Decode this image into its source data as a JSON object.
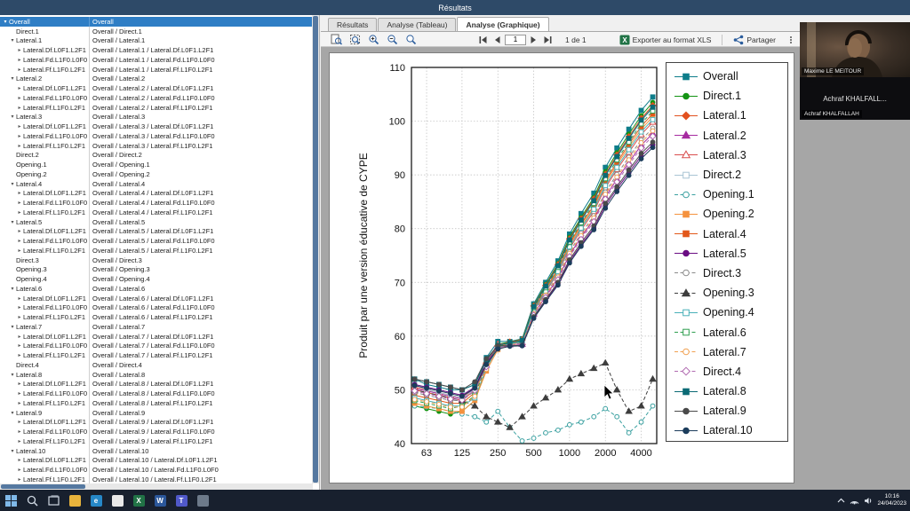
{
  "window": {
    "title": "Résultats"
  },
  "tabs": [
    {
      "label": "Résultats",
      "active": false
    },
    {
      "label": "Analyse (Tableau)",
      "active": false
    },
    {
      "label": "Analyse (Graphique)",
      "active": true
    }
  ],
  "toolbar": {
    "page_value": "1",
    "page_indicator": "1 de 1",
    "export_label": "Exporter au format XLS",
    "share_label": "Partager"
  },
  "tree": {
    "rows": [
      {
        "label": "Overall",
        "path": "Overall",
        "indent": 0,
        "expand": "open",
        "selected": true
      },
      {
        "label": "Direct.1",
        "path": "Overall / Direct.1",
        "indent": 1,
        "expand": "none"
      },
      {
        "label": "Lateral.1",
        "path": "Overall / Lateral.1",
        "indent": 1,
        "expand": "open"
      },
      {
        "label": "Lateral.Df.L0F1.L2F1",
        "path": "Overall / Lateral.1 / Lateral.Df.L0F1.L2F1",
        "indent": 2,
        "expand": "closed"
      },
      {
        "label": "Lateral.Fd.L1F0.L0F0",
        "path": "Overall / Lateral.1 / Lateral.Fd.L1F0.L0F0",
        "indent": 2,
        "expand": "closed"
      },
      {
        "label": "Lateral.Ff.L1F0.L2F1",
        "path": "Overall / Lateral.1 / Lateral.Ff.L1F0.L2F1",
        "indent": 2,
        "expand": "closed"
      },
      {
        "label": "Lateral.2",
        "path": "Overall / Lateral.2",
        "indent": 1,
        "expand": "open"
      },
      {
        "label": "Lateral.Df.L0F1.L2F1",
        "path": "Overall / Lateral.2 / Lateral.Df.L0F1.L2F1",
        "indent": 2,
        "expand": "closed"
      },
      {
        "label": "Lateral.Fd.L1F0.L0F0",
        "path": "Overall / Lateral.2 / Lateral.Fd.L1F0.L0F0",
        "indent": 2,
        "expand": "closed"
      },
      {
        "label": "Lateral.Ff.L1F0.L2F1",
        "path": "Overall / Lateral.2 / Lateral.Ff.L1F0.L2F1",
        "indent": 2,
        "expand": "closed"
      },
      {
        "label": "Lateral.3",
        "path": "Overall / Lateral.3",
        "indent": 1,
        "expand": "open"
      },
      {
        "label": "Lateral.Df.L0F1.L2F1",
        "path": "Overall / Lateral.3 / Lateral.Df.L0F1.L2F1",
        "indent": 2,
        "expand": "closed"
      },
      {
        "label": "Lateral.Fd.L1F0.L0F0",
        "path": "Overall / Lateral.3 / Lateral.Fd.L1F0.L0F0",
        "indent": 2,
        "expand": "closed"
      },
      {
        "label": "Lateral.Ff.L1F0.L2F1",
        "path": "Overall / Lateral.3 / Lateral.Ff.L1F0.L2F1",
        "indent": 2,
        "expand": "closed"
      },
      {
        "label": "Direct.2",
        "path": "Overall / Direct.2",
        "indent": 1,
        "expand": "none"
      },
      {
        "label": "Opening.1",
        "path": "Overall / Opening.1",
        "indent": 1,
        "expand": "none"
      },
      {
        "label": "Opening.2",
        "path": "Overall / Opening.2",
        "indent": 1,
        "expand": "none"
      },
      {
        "label": "Lateral.4",
        "path": "Overall / Lateral.4",
        "indent": 1,
        "expand": "open"
      },
      {
        "label": "Lateral.Df.L0F1.L2F1",
        "path": "Overall / Lateral.4 / Lateral.Df.L0F1.L2F1",
        "indent": 2,
        "expand": "closed"
      },
      {
        "label": "Lateral.Fd.L1F0.L0F0",
        "path": "Overall / Lateral.4 / Lateral.Fd.L1F0.L0F0",
        "indent": 2,
        "expand": "closed"
      },
      {
        "label": "Lateral.Ff.L1F0.L2F1",
        "path": "Overall / Lateral.4 / Lateral.Ff.L1F0.L2F1",
        "indent": 2,
        "expand": "closed"
      },
      {
        "label": "Lateral.5",
        "path": "Overall / Lateral.5",
        "indent": 1,
        "expand": "open"
      },
      {
        "label": "Lateral.Df.L0F1.L2F1",
        "path": "Overall / Lateral.5 / Lateral.Df.L0F1.L2F1",
        "indent": 2,
        "expand": "closed"
      },
      {
        "label": "Lateral.Fd.L1F0.L0F0",
        "path": "Overall / Lateral.5 / Lateral.Fd.L1F0.L0F0",
        "indent": 2,
        "expand": "closed"
      },
      {
        "label": "Lateral.Ff.L1F0.L2F1",
        "path": "Overall / Lateral.5 / Lateral.Ff.L1F0.L2F1",
        "indent": 2,
        "expand": "closed"
      },
      {
        "label": "Direct.3",
        "path": "Overall / Direct.3",
        "indent": 1,
        "expand": "none"
      },
      {
        "label": "Opening.3",
        "path": "Overall / Opening.3",
        "indent": 1,
        "expand": "none"
      },
      {
        "label": "Opening.4",
        "path": "Overall / Opening.4",
        "indent": 1,
        "expand": "none"
      },
      {
        "label": "Lateral.6",
        "path": "Overall / Lateral.6",
        "indent": 1,
        "expand": "open"
      },
      {
        "label": "Lateral.Df.L0F1.L2F1",
        "path": "Overall / Lateral.6 / Lateral.Df.L0F1.L2F1",
        "indent": 2,
        "expand": "closed"
      },
      {
        "label": "Lateral.Fd.L1F0.L0F0",
        "path": "Overall / Lateral.6 / Lateral.Fd.L1F0.L0F0",
        "indent": 2,
        "expand": "closed"
      },
      {
        "label": "Lateral.Ff.L1F0.L2F1",
        "path": "Overall / Lateral.6 / Lateral.Ff.L1F0.L2F1",
        "indent": 2,
        "expand": "closed"
      },
      {
        "label": "Lateral.7",
        "path": "Overall / Lateral.7",
        "indent": 1,
        "expand": "open"
      },
      {
        "label": "Lateral.Df.L0F1.L2F1",
        "path": "Overall / Lateral.7 / Lateral.Df.L0F1.L2F1",
        "indent": 2,
        "expand": "closed"
      },
      {
        "label": "Lateral.Fd.L1F0.L0F0",
        "path": "Overall / Lateral.7 / Lateral.Fd.L1F0.L0F0",
        "indent": 2,
        "expand": "closed"
      },
      {
        "label": "Lateral.Ff.L1F0.L2F1",
        "path": "Overall / Lateral.7 / Lateral.Ff.L1F0.L2F1",
        "indent": 2,
        "expand": "closed"
      },
      {
        "label": "Direct.4",
        "path": "Overall / Direct.4",
        "indent": 1,
        "expand": "none"
      },
      {
        "label": "Lateral.8",
        "path": "Overall / Lateral.8",
        "indent": 1,
        "expand": "open"
      },
      {
        "label": "Lateral.Df.L0F1.L2F1",
        "path": "Overall / Lateral.8 / Lateral.Df.L0F1.L2F1",
        "indent": 2,
        "expand": "closed"
      },
      {
        "label": "Lateral.Fd.L1F0.L0F0",
        "path": "Overall / Lateral.8 / Lateral.Fd.L1F0.L0F0",
        "indent": 2,
        "expand": "closed"
      },
      {
        "label": "Lateral.Ff.L1F0.L2F1",
        "path": "Overall / Lateral.8 / Lateral.Ff.L1F0.L2F1",
        "indent": 2,
        "expand": "closed"
      },
      {
        "label": "Lateral.9",
        "path": "Overall / Lateral.9",
        "indent": 1,
        "expand": "open"
      },
      {
        "label": "Lateral.Df.L0F1.L2F1",
        "path": "Overall / Lateral.9 / Lateral.Df.L0F1.L2F1",
        "indent": 2,
        "expand": "closed"
      },
      {
        "label": "Lateral.Fd.L1F0.L0F0",
        "path": "Overall / Lateral.9 / Lateral.Fd.L1F0.L0F0",
        "indent": 2,
        "expand": "closed"
      },
      {
        "label": "Lateral.Ff.L1F0.L2F1",
        "path": "Overall / Lateral.9 / Lateral.Ff.L1F0.L2F1",
        "indent": 2,
        "expand": "closed"
      },
      {
        "label": "Lateral.10",
        "path": "Overall / Lateral.10",
        "indent": 1,
        "expand": "open"
      },
      {
        "label": "Lateral.Df.L0F1.L2F1",
        "path": "Overall / Lateral.10 / Lateral.Df.L0F1.L2F1",
        "indent": 2,
        "expand": "closed"
      },
      {
        "label": "Lateral.Fd.L1F0.L0F0",
        "path": "Overall / Lateral.10 / Lateral.Fd.L1F0.L0F0",
        "indent": 2,
        "expand": "closed"
      },
      {
        "label": "Lateral.Ff.L1F0.L2F1",
        "path": "Overall / Lateral.10 / Lateral.Ff.L1F0.L2F1",
        "indent": 2,
        "expand": "closed"
      }
    ]
  },
  "chart_data": {
    "type": "line",
    "x_scale": "log",
    "x": [
      50,
      63,
      80,
      100,
      125,
      160,
      200,
      250,
      315,
      400,
      500,
      630,
      800,
      1000,
      1250,
      1600,
      2000,
      2500,
      3150,
      4000,
      5000
    ],
    "x_ticks": [
      63,
      125,
      250,
      500,
      1000,
      2000,
      4000
    ],
    "ylabel": "Produit par une version éducative de CYPE",
    "ylim": [
      40,
      110
    ],
    "y_ticks": [
      40,
      50,
      60,
      70,
      80,
      90,
      100,
      110
    ],
    "grid": true,
    "legend_position": "right",
    "series": [
      {
        "name": "Overall",
        "color": "#0e7d8a",
        "marker": "square",
        "filled": true,
        "dashed": false,
        "values": [
          52,
          51,
          50.5,
          50,
          50,
          51,
          56,
          59,
          59,
          59.5,
          66,
          70,
          74,
          79,
          82.8,
          86.6,
          91.4,
          95,
          98.5,
          102,
          104.5
        ]
      },
      {
        "name": "Direct.1",
        "color": "#149414",
        "marker": "circle",
        "filled": true,
        "dashed": false,
        "values": [
          47,
          46.5,
          46,
          45.5,
          46,
          48,
          54,
          58.5,
          58.9,
          59.4,
          65.7,
          69.6,
          73.5,
          78.4,
          82.1,
          85.8,
          90.6,
          94.1,
          97.6,
          101,
          103.5
        ]
      },
      {
        "name": "Lateral.1",
        "color": "#e2511f",
        "marker": "diamond",
        "filled": true,
        "dashed": false,
        "values": [
          50,
          49.5,
          49,
          48.5,
          48,
          50,
          55,
          58.2,
          58.9,
          59.3,
          65.6,
          69.4,
          73.3,
          78.1,
          81.8,
          85.5,
          90.1,
          93.7,
          97.1,
          100.5,
          102.9
        ]
      },
      {
        "name": "Lateral.2",
        "color": "#a62aa0",
        "marker": "triangle",
        "filled": true,
        "dashed": false,
        "values": [
          50.2,
          49.8,
          49.3,
          48.8,
          48.3,
          50.2,
          54.6,
          58.1,
          58.4,
          58.5,
          64.1,
          67.4,
          70.8,
          75.1,
          78.4,
          81.7,
          85.9,
          89.2,
          92.3,
          95.5,
          97.7
        ]
      },
      {
        "name": "Lateral.3",
        "color": "#d94f4f",
        "marker": "triangle",
        "filled": false,
        "dashed": false,
        "values": [
          50.5,
          50,
          49.5,
          49,
          48.5,
          50.5,
          55.2,
          58.5,
          58.6,
          58.8,
          64.7,
          68.2,
          71.8,
          76.3,
          79.7,
          83.2,
          87.6,
          91,
          94.2,
          97.5,
          99.8
        ]
      },
      {
        "name": "Direct.2",
        "color": "#a9c4d4",
        "marker": "square",
        "filled": false,
        "dashed": false,
        "values": [
          51,
          50,
          49.5,
          49,
          48.5,
          50,
          55,
          58,
          58.8,
          59.2,
          65.4,
          69.2,
          73,
          77.8,
          81.4,
          85.1,
          89.7,
          93.2,
          96.6,
          100,
          102.4
        ]
      },
      {
        "name": "Opening.1",
        "color": "#3aa0a0",
        "marker": "circle",
        "filled": false,
        "dashed": true,
        "values": [
          47,
          46.8,
          46.5,
          46,
          45.5,
          45,
          44,
          46,
          43,
          40.5,
          41,
          42,
          42.5,
          43.5,
          44,
          45,
          46.5,
          45,
          42,
          44,
          47
        ]
      },
      {
        "name": "Opening.2",
        "color": "#f5923e",
        "marker": "square",
        "filled": true,
        "dashed": false,
        "values": [
          47.5,
          47,
          46.5,
          46,
          46,
          48,
          53.5,
          57.5,
          58.7,
          59,
          65,
          68.6,
          72.3,
          76.9,
          80.4,
          83.9,
          88.5,
          91.9,
          95.2,
          98.5,
          100.8
        ]
      },
      {
        "name": "Lateral.4",
        "color": "#e2581a",
        "marker": "square",
        "filled": true,
        "dashed": false,
        "values": [
          49,
          48.5,
          48,
          47.5,
          47.5,
          49.5,
          54.8,
          58,
          58.7,
          59.1,
          65.1,
          68.8,
          72.5,
          77.2,
          80.8,
          84.3,
          88.9,
          92.3,
          95.7,
          99,
          101.4
        ]
      },
      {
        "name": "Lateral.5",
        "color": "#6a0d83",
        "marker": "circle",
        "filled": true,
        "dashed": false,
        "values": [
          51,
          50.5,
          50,
          49.5,
          49,
          50.5,
          55,
          57.9,
          58.2,
          58.2,
          63.5,
          66.6,
          69.8,
          73.9,
          77,
          80.1,
          84.3,
          87.4,
          90.4,
          93.5,
          95.6
        ]
      },
      {
        "name": "Direct.3",
        "color": "#8a8a8a",
        "marker": "circle",
        "filled": false,
        "dashed": true,
        "values": [
          49.5,
          49,
          48.5,
          48,
          48,
          49.8,
          54.2,
          57.7,
          58.5,
          58.7,
          64.4,
          67.8,
          71.3,
          75.7,
          79.1,
          82.4,
          86.8,
          90.1,
          93.3,
          96.5,
          98.7
        ]
      },
      {
        "name": "Opening.3",
        "color": "#3d3d3d",
        "marker": "triangle",
        "filled": true,
        "dashed": true,
        "values": [
          50,
          49.5,
          49,
          48.5,
          48,
          47,
          45,
          44,
          43,
          45,
          47,
          48.5,
          50,
          52,
          53,
          54,
          55,
          50,
          46,
          47,
          52
        ]
      },
      {
        "name": "Opening.4",
        "color": "#49b0b8",
        "marker": "square",
        "filled": false,
        "dashed": false,
        "values": [
          48.5,
          48,
          47.5,
          47,
          47,
          48.5,
          54,
          57.8,
          58.6,
          58.9,
          64.8,
          68.4,
          72,
          76.6,
          80.1,
          83.6,
          88,
          91.4,
          94.7,
          98,
          100.3
        ]
      },
      {
        "name": "Lateral.6",
        "color": "#2f9e4f",
        "marker": "square",
        "filled": false,
        "dashed": true,
        "values": [
          48,
          47.5,
          47,
          46.5,
          47,
          49,
          54.5,
          58,
          58.8,
          59.1,
          65.3,
          69,
          72.8,
          77.5,
          81.1,
          84.7,
          89.3,
          92.8,
          96.1,
          99.5,
          101.9
        ]
      },
      {
        "name": "Lateral.7",
        "color": "#f0a050",
        "marker": "circle",
        "filled": false,
        "dashed": true,
        "values": [
          48.2,
          47.8,
          47.3,
          46.8,
          46.8,
          48.8,
          53.8,
          57.4,
          58.4,
          58.6,
          64.2,
          67.6,
          71,
          75.4,
          78.7,
          82,
          86.4,
          89.6,
          92.8,
          96,
          98.2
        ]
      },
      {
        "name": "Direct.4",
        "color": "#b06ab0",
        "marker": "diamond",
        "filled": false,
        "dashed": true,
        "values": [
          49.8,
          49.3,
          48.8,
          48.3,
          48.1,
          49.9,
          54.3,
          57.8,
          58.3,
          58.5,
          63.9,
          67.2,
          70.5,
          74.8,
          78,
          81.3,
          85.5,
          88.7,
          91.9,
          95,
          97.2
        ]
      },
      {
        "name": "Lateral.8",
        "color": "#0b6a75",
        "marker": "square",
        "filled": true,
        "dashed": false,
        "values": [
          52,
          51.5,
          51,
          50.5,
          50,
          51,
          55.5,
          58.3,
          58.8,
          59.2,
          65.5,
          69.3,
          73.1,
          77.9,
          81.6,
          85.2,
          89.9,
          93.4,
          96.8,
          100.2,
          102.6
        ]
      },
      {
        "name": "Lateral.9",
        "color": "#4a4a4a",
        "marker": "circle",
        "filled": true,
        "dashed": false,
        "values": [
          52,
          51.5,
          51,
          50.5,
          50,
          51.5,
          55.8,
          58.2,
          58.2,
          58.3,
          63.6,
          66.8,
          70,
          74.2,
          77.4,
          80.5,
          84.7,
          87.8,
          90.9,
          94,
          96.1
        ]
      },
      {
        "name": "Lateral.10",
        "color": "#1c3d5c",
        "marker": "circle",
        "filled": true,
        "dashed": false,
        "values": [
          50.8,
          50.3,
          49.8,
          49.3,
          48.8,
          50.3,
          54.7,
          57.6,
          58.1,
          58.2,
          63.3,
          66.4,
          69.5,
          73.6,
          76.7,
          79.8,
          83.8,
          86.9,
          89.9,
          93,
          95.1
        ]
      }
    ]
  },
  "video_call": {
    "tiles": [
      {
        "name_label": "Maxime LE MEITOUR",
        "has_video": true
      },
      {
        "display_name": "Achraf KHALFALL...",
        "name_label": "Achraf KHALFALLAH",
        "has_video": false
      }
    ]
  },
  "taskbar": {
    "time": "10:16",
    "date": "24/04/2023",
    "icons": [
      {
        "name": "start"
      },
      {
        "name": "search"
      },
      {
        "name": "task-view"
      },
      {
        "name": "file-explorer"
      },
      {
        "name": "edge"
      },
      {
        "name": "chrome"
      },
      {
        "name": "excel"
      },
      {
        "name": "word"
      },
      {
        "name": "teams"
      },
      {
        "name": "app"
      }
    ]
  }
}
